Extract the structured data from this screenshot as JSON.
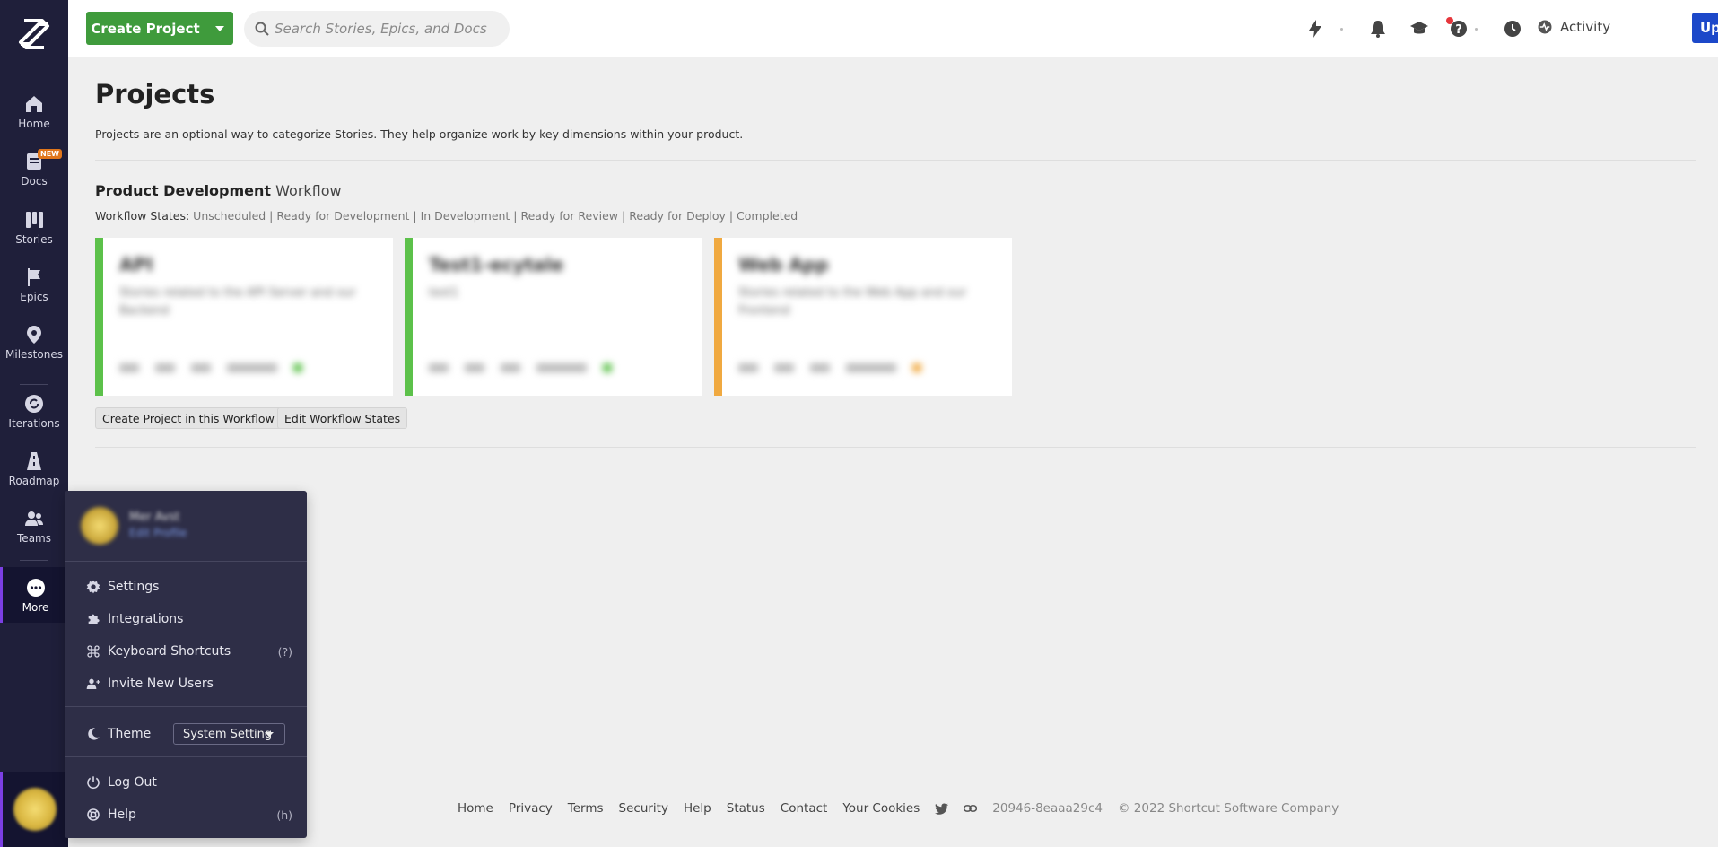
{
  "sidebar": {
    "items": [
      {
        "label": "Home",
        "icon": "home-icon"
      },
      {
        "label": "Docs",
        "icon": "docs-icon",
        "badge": "NEW"
      },
      {
        "label": "Stories",
        "icon": "stories-icon"
      },
      {
        "label": "Epics",
        "icon": "epics-icon"
      },
      {
        "label": "Milestones",
        "icon": "milestones-icon"
      },
      {
        "label": "Iterations",
        "icon": "iterations-icon"
      },
      {
        "label": "Roadmap",
        "icon": "roadmap-icon"
      },
      {
        "label": "Teams",
        "icon": "teams-icon"
      },
      {
        "label": "More",
        "icon": "more-icon"
      }
    ]
  },
  "topbar": {
    "create_label": "Create Project",
    "search_placeholder": "Search Stories, Epics, and Docs",
    "activity_label": "Activity",
    "upgrade_label": "Upgrade"
  },
  "main": {
    "title": "Projects",
    "description": "Projects are an optional way to categorize Stories. They help organize work by key dimensions within your product.",
    "workflow": {
      "name": "Product Development",
      "suffix": "Workflow",
      "states_label": "Workflow States:",
      "states": "Unscheduled | Ready for Development | In Development | Ready for Review | Ready for Deploy | Completed",
      "projects": [
        {
          "name": "API",
          "description": "Stories related to the API Server and our Backend",
          "color": "#5cc14a"
        },
        {
          "name": "Test1-ecytale",
          "description": "test1",
          "color": "#5cc14a"
        },
        {
          "name": "Web App",
          "description": "Stories related to the Web App and our Frontend",
          "color": "#f0a940"
        }
      ],
      "create_in_workflow_label": "Create Project in this Workflow",
      "edit_states_label": "Edit Workflow States"
    }
  },
  "menu": {
    "profile_name": "Mer Avst",
    "profile_link": "Edit Profile",
    "items": [
      {
        "label": "Settings",
        "icon": "gear-icon"
      },
      {
        "label": "Integrations",
        "icon": "puzzle-icon"
      },
      {
        "label": "Keyboard Shortcuts",
        "icon": "command-icon",
        "hint": "(?)"
      },
      {
        "label": "Invite New Users",
        "icon": "user-plus-icon"
      }
    ],
    "theme_label": "Theme",
    "theme_value": "System Setting",
    "logout_label": "Log Out",
    "help_label": "Help",
    "help_hint": "(h)"
  },
  "footer": {
    "links": [
      "Home",
      "Privacy",
      "Terms",
      "Security",
      "Help",
      "Status",
      "Contact",
      "Your Cookies"
    ],
    "version": "20946-8eaaa29c4",
    "copyright": "© 2022 Shortcut Software Company"
  }
}
